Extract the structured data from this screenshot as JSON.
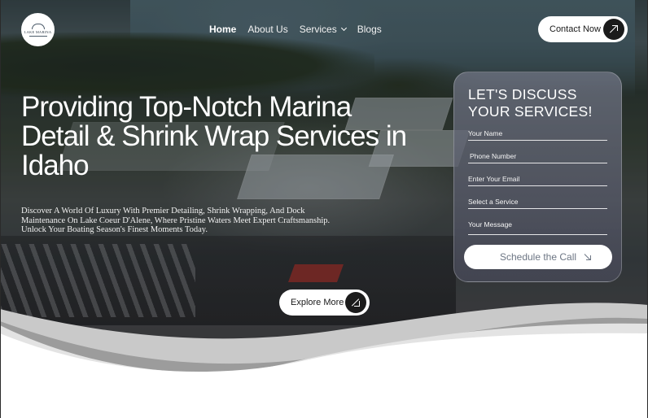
{
  "logo": {
    "text": "LAKE MARINA"
  },
  "nav": {
    "items": [
      {
        "label": "Home",
        "active": true
      },
      {
        "label": "About Us"
      },
      {
        "label": "Services"
      },
      {
        "label": "Blogs"
      }
    ]
  },
  "header": {
    "contact_label": "Contact Now"
  },
  "hero": {
    "headline": "Providing Top-Notch Marina Detail & Shrink Wrap Services in Idaho",
    "subtext": "Discover A World Of Luxury With Premier Detailing, Shrink Wrapping, And Dock Maintenance On Lake Coeur D'Alene, Where Pristine Waters Meet Expert Craftsmanship. Unlock Your Boating Season's Finest Moments Today.",
    "explore_label": "Explore More"
  },
  "form": {
    "title": "LET'S DISCUSS YOUR SERVICES!",
    "fields": [
      {
        "placeholder": "Your Name"
      },
      {
        "placeholder": "Phone Number"
      },
      {
        "placeholder": "Enter Your Email"
      },
      {
        "placeholder": "Select a Service"
      },
      {
        "placeholder": "Your Message"
      }
    ],
    "submit_label": "Schedule the Call"
  },
  "colors": {
    "accent_dark": "#1b1b1b",
    "form_bg": "#5f6372",
    "wave_light": "#d9d9d9",
    "wave_mid": "#a9a9a9"
  }
}
